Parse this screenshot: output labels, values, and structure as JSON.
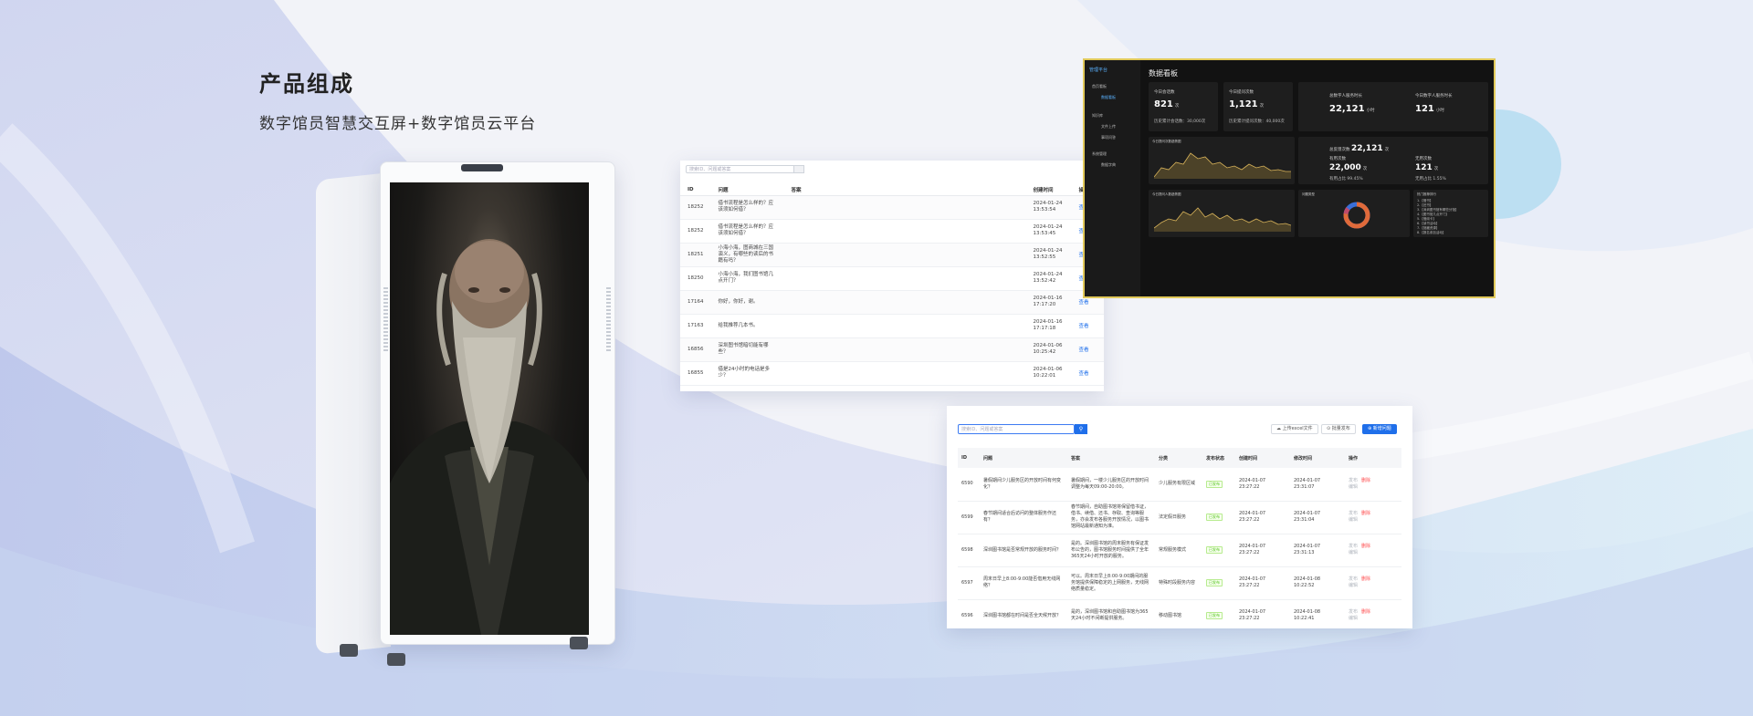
{
  "intro": {
    "title": "产品组成",
    "subtitle": "数字馆员智慧交互屏+数字馆员云平台"
  },
  "colors": {
    "background": "#eef0f6",
    "accent_blue": "#1f6fea",
    "dashboard_gold": "#e1c95a"
  },
  "kiosk": {
    "screen_content": "portrait of elderly bearded man"
  },
  "qa_list": {
    "search_placeholder": "搜索ID、问题或答案",
    "columns": [
      "ID",
      "问题",
      "答案",
      "创建时间",
      "操作"
    ],
    "rows": [
      {
        "id": "18252",
        "question": "借书流程是怎么样的？应该须如何借？",
        "answer": "",
        "time": "2024-01-24 13:53:54",
        "op": "查看"
      },
      {
        "id": "18252",
        "question": "借书流程是怎么样的？应该须如何借？",
        "answer": "",
        "time": "2024-01-24 13:53:45",
        "op": "查看"
      },
      {
        "id": "18251",
        "question": "小海小海，图商城在三国演义，有哪些的读后的书籍有吗？",
        "answer": "",
        "time": "2024-01-24 13:52:55",
        "op": "查看"
      },
      {
        "id": "18250",
        "question": "小海小海，我们图书馆几点开门？",
        "answer": "",
        "time": "2024-01-24 13:52:42",
        "op": "查看"
      },
      {
        "id": "17164",
        "question": "你好，你好，谢。",
        "answer": "",
        "time": "2024-01-16 17:17:20",
        "op": "查看"
      },
      {
        "id": "17163",
        "question": "给我推荐几本书。",
        "answer": "",
        "time": "2024-01-16 17:17:18",
        "op": "查看"
      },
      {
        "id": "16856",
        "question": "深圳图书馆暗切能有哪些？",
        "answer": "",
        "time": "2024-01-06 10:25:42",
        "op": "查看"
      },
      {
        "id": "16855",
        "question": "借是24小时的电话是多少？",
        "answer": "",
        "time": "2024-01-06 10:22:01",
        "op": "查看"
      }
    ]
  },
  "dashboard": {
    "logo": "管理平台",
    "title": "数据看板",
    "menu": [
      "首页看板",
      "数据看板",
      "知识库",
      "文件上传",
      "事项问答",
      "系统管理",
      "数据字典"
    ],
    "card1": {
      "label": "今日会话数",
      "value": "821",
      "unit": "次",
      "sub": "历史累计会话数：30,000次"
    },
    "card2": {
      "label": "今日提问次数",
      "value": "1,121",
      "unit": "次",
      "sub": "历史累计提问次数：40,000次"
    },
    "card3": {
      "label": "总数字人服务时长",
      "value": "22,121",
      "unit": "小时"
    },
    "card4": {
      "label": "今日数字人服务时长",
      "value": "121",
      "unit": "小时"
    },
    "card5": {
      "label": "总反馈次数",
      "value": "22,121",
      "unit": "次",
      "label2": "有用次数",
      "value2": "22,000",
      "unit2": "次",
      "pct2": "有用占比 99.45%",
      "label3": "无用次数",
      "value3": "121",
      "unit3": "次",
      "pct3": "无用占比 1.55%"
    },
    "chart1_title": "今日提问次数趋势图",
    "chart2_title": "今日提问人数趋势图",
    "donut_title": "问题类型",
    "hot_title": "热门推荐排行",
    "hot_items": [
      "1.【借书】",
      "2.【还书】",
      "3.【深圳图书馆有哪些分馆】",
      "4.【图书馆几点开门】",
      "5.【借阅卡】",
      "6.【读书活动】",
      "7.【馆藏资源】",
      "8.【报名参加活动】"
    ]
  },
  "qa_manage": {
    "search_placeholder": "搜索ID、问题或答案",
    "btn_import": "上传excel文件",
    "btn_batch": "批量发布",
    "btn_new": "新增问题",
    "columns": [
      "ID",
      "问题",
      "答案",
      "分类",
      "发布状态",
      "创建时间",
      "修改时间",
      "操作"
    ],
    "rows": [
      {
        "id": "6590",
        "question": "暑假期间少儿服务区的开放时间有何变化？",
        "answer": "暑假期间，一楼少儿服务区的开放时间调整为每天09:00-20:00。",
        "category": "少儿服务有限区域",
        "status": "已发布",
        "created": "2024-01-07 23:27:22",
        "modified": "2024-01-07 23:31:07",
        "ops": [
          "发布",
          "删除",
          "编辑"
        ]
      },
      {
        "id": "6599",
        "question": "春节期间适合后访问的整体服务作还有？",
        "answer": "春节期间，自助图书馆将保留借书证，借书、续借、还书、存取、查询等服务，亦会发布各服务开放情况，以图书馆网站最新通知为准。",
        "category": "法定假日服务",
        "status": "已发布",
        "created": "2024-01-07 23:27:22",
        "modified": "2024-01-07 23:31:04",
        "ops": [
          "发布",
          "删除",
          "编辑"
        ]
      },
      {
        "id": "6598",
        "question": "深圳图书馆是否常规开放的服务时间？",
        "answer": "是的。深圳图书馆的周末服务有保证发布公告的，图书馆服务时间提供了全年365天24小时开放的服务。",
        "category": "常规服务模式",
        "status": "已发布",
        "created": "2024-01-07 23:27:22",
        "modified": "2024-01-07 23:31:13",
        "ops": [
          "发布",
          "删除",
          "编辑"
        ]
      },
      {
        "id": "6597",
        "question": "周末日早上8:00-9:00能否借用无线网络？",
        "answer": "可以。周末日早上8:00-9:00期间的服务馆提供保障稳定的上网服务，无线网络质量稳定。",
        "category": "特殊时段服务内容",
        "status": "已发布",
        "created": "2024-01-07 23:27:22",
        "modified": "2024-01-08 10:22:52",
        "ops": [
          "发布",
          "删除",
          "编辑"
        ]
      },
      {
        "id": "6596",
        "question": "深圳图书馆都在时间是否全天候开放？",
        "answer": "是的，深圳图书馆和自助图书馆为365天24小时不间断提供服务。",
        "category": "移动图书馆",
        "status": "已发布",
        "created": "2024-01-07 23:27:22",
        "modified": "2024-01-08 10:22:41",
        "ops": [
          "发布",
          "删除",
          "编辑"
        ]
      }
    ]
  }
}
